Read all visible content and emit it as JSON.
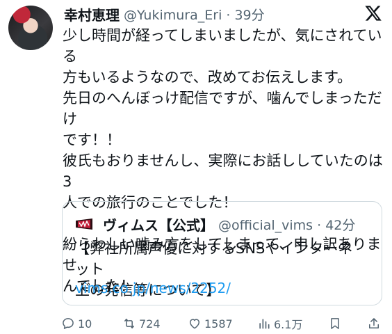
{
  "tweet": {
    "author_name": "幸村恵理",
    "handle_time": "@Yukimura_Eri · 39分",
    "text": "少し時間が経ってしまいましたが、気にされている\n方もいるようなので、改めてお伝えします。\n先日のへんぼっけ配信ですが、噛んでしまっただけ\nです！！\n彼氏もおりませんし、実際にお話ししていたのは3\n人での旅行のことでした！\n\n紛らわしい噛み方をしてしまって、申し訳ありませ\nんでした！"
  },
  "quote": {
    "author_name": "ヴィムス【公式】",
    "handle_time": "@official_vims · 42分",
    "text": "【弊社所属声優に対するSNSやインターネット\n上の発信等について】",
    "link": "vims.co.jp/news/2252/"
  },
  "actions": {
    "replies": "10",
    "retweets": "724",
    "likes": "1587",
    "views": "6.1万"
  },
  "icons": [
    "avatar",
    "x-logo-icon",
    "vims-logo-icon",
    "reply-icon",
    "retweet-icon",
    "like-icon",
    "views-icon",
    "bookmark-icon",
    "share-icon"
  ],
  "colors": {
    "text": "#0f1419",
    "secondary": "#536471",
    "link": "#1d9bf0",
    "border": "#cfd9de"
  }
}
